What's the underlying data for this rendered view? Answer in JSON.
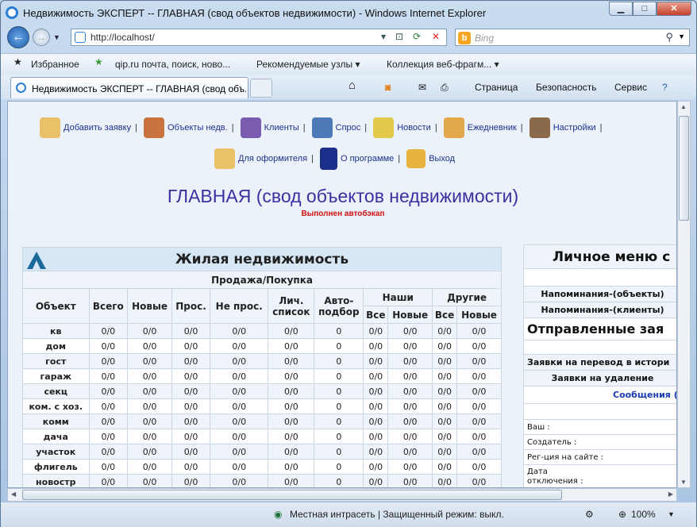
{
  "window": {
    "title": "Недвижимость ЭКСПЕРТ -- ГЛАВНАЯ (свод объектов недвижимости) - Windows Internet Explorer"
  },
  "nav": {
    "url": "http://localhost/",
    "search_placeholder": "Bing"
  },
  "favorites": {
    "label": "Избранное",
    "items": [
      "qip.ru почта, поиск, ново...",
      "Рекомендуемые узлы ▾",
      "Коллекция веб-фрагм... ▾"
    ]
  },
  "tab": {
    "title": "Недвижимость ЭКСПЕРТ -- ГЛАВНАЯ (свод объ..."
  },
  "command": {
    "page": "Страница",
    "safety": "Безопасность",
    "service": "Сервис"
  },
  "status": {
    "zone": "Местная интрасеть | Защищенный режим: выкл.",
    "zoom": "100%"
  },
  "menu": {
    "row1": [
      "Добавить заявку",
      "Объекты недв.",
      "Клиенты",
      "Спрос",
      "Новости",
      "Ежедневник",
      "Настройки"
    ],
    "row2": [
      "Для оформителя",
      "О программе",
      "Выход"
    ]
  },
  "page": {
    "title": "ГЛАВНАЯ (свод объектов недвижимости)",
    "notice": "Выполнен автобэкап"
  },
  "table": {
    "title": "Жилая недвижимость",
    "subtitle": "Продажа/Покупка",
    "headers": {
      "object": "Объект",
      "total": "Всего",
      "new": "Новые",
      "pros": "Прос.",
      "notpros": "Не прос.",
      "personal": "Лич. список",
      "auto": "Авто-подбор",
      "ours": "Наши",
      "others": "Другие",
      "all": "Все",
      "new2": "Новые"
    },
    "rows": [
      [
        "кв",
        "0/0",
        "0/0",
        "0/0",
        "0/0",
        "0/0",
        "0",
        "0/0",
        "0/0",
        "0/0",
        "0/0"
      ],
      [
        "дом",
        "0/0",
        "0/0",
        "0/0",
        "0/0",
        "0/0",
        "0",
        "0/0",
        "0/0",
        "0/0",
        "0/0"
      ],
      [
        "гост",
        "0/0",
        "0/0",
        "0/0",
        "0/0",
        "0/0",
        "0",
        "0/0",
        "0/0",
        "0/0",
        "0/0"
      ],
      [
        "гараж",
        "0/0",
        "0/0",
        "0/0",
        "0/0",
        "0/0",
        "0",
        "0/0",
        "0/0",
        "0/0",
        "0/0"
      ],
      [
        "секц",
        "0/0",
        "0/0",
        "0/0",
        "0/0",
        "0/0",
        "0",
        "0/0",
        "0/0",
        "0/0",
        "0/0"
      ],
      [
        "ком. с хоз.",
        "0/0",
        "0/0",
        "0/0",
        "0/0",
        "0/0",
        "0",
        "0/0",
        "0/0",
        "0/0",
        "0/0"
      ],
      [
        "комм",
        "0/0",
        "0/0",
        "0/0",
        "0/0",
        "0/0",
        "0",
        "0/0",
        "0/0",
        "0/0",
        "0/0"
      ],
      [
        "дача",
        "0/0",
        "0/0",
        "0/0",
        "0/0",
        "0/0",
        "0",
        "0/0",
        "0/0",
        "0/0",
        "0/0"
      ],
      [
        "участок",
        "0/0",
        "0/0",
        "0/0",
        "0/0",
        "0/0",
        "0",
        "0/0",
        "0/0",
        "0/0",
        "0/0"
      ],
      [
        "флигель",
        "0/0",
        "0/0",
        "0/0",
        "0/0",
        "0/0",
        "0",
        "0/0",
        "0/0",
        "0/0",
        "0/0"
      ],
      [
        "новостр",
        "0/0",
        "0/0",
        "0/0",
        "0/0",
        "0/0",
        "0",
        "0/0",
        "0/0",
        "0/0",
        "0/0"
      ]
    ]
  },
  "right": {
    "title": "Личное меню с",
    "remind_objects": "Напоминания-(объекты)",
    "remind_clients": "Напоминания-(клиенты)",
    "sent": "Отправленные зая",
    "transfer": "Заявки на перевод в истори",
    "delete": "Заявки на удаление",
    "messages": "Сообщения (",
    "info": [
      "Ваш :",
      "Создатель :",
      "Рег-ция на сайте :",
      "Дата",
      "отключения :"
    ]
  },
  "colors": {
    "menu_text": "#1f2f8f",
    "title": "#3a31a0",
    "notice": "#d01010",
    "header_bg": "#d7e7f6"
  }
}
